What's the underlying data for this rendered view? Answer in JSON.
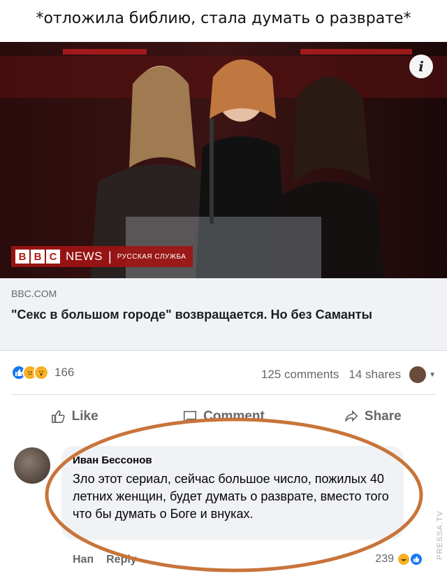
{
  "caption": "*отложила библию, стала думать о разврате*",
  "post": {
    "image_alt": "three women at an award podium",
    "info_label": "i",
    "bbc_letters": [
      "B",
      "B",
      "C"
    ],
    "bbc_news": "NEWS",
    "bbc_separator": "|",
    "bbc_service": "РУССКАЯ СЛУЖБА",
    "domain": "BBC.COM",
    "title": "\"Секс в большом городе\" возвращается. Но без Саманты"
  },
  "stats": {
    "reaction_count": "166",
    "comments": "125 comments",
    "shares": "14 shares"
  },
  "actions": {
    "like": "Like",
    "comment": "Comment",
    "share": "Share"
  },
  "comment": {
    "author": "Иван Бессонов",
    "text": "Зло этот сериал, сейчас большое число, пожилых 40 летних женщин, будет думать о разврате, вместо того что бы думать о Боге и внуках.",
    "footer_left": "Нап",
    "reply": "Reply",
    "reaction_count": "239"
  },
  "watermark": "PRESSA.TV",
  "colors": {
    "accent": "#1877f2",
    "oval": "#c8743a",
    "bbc_red": "#a01414"
  }
}
